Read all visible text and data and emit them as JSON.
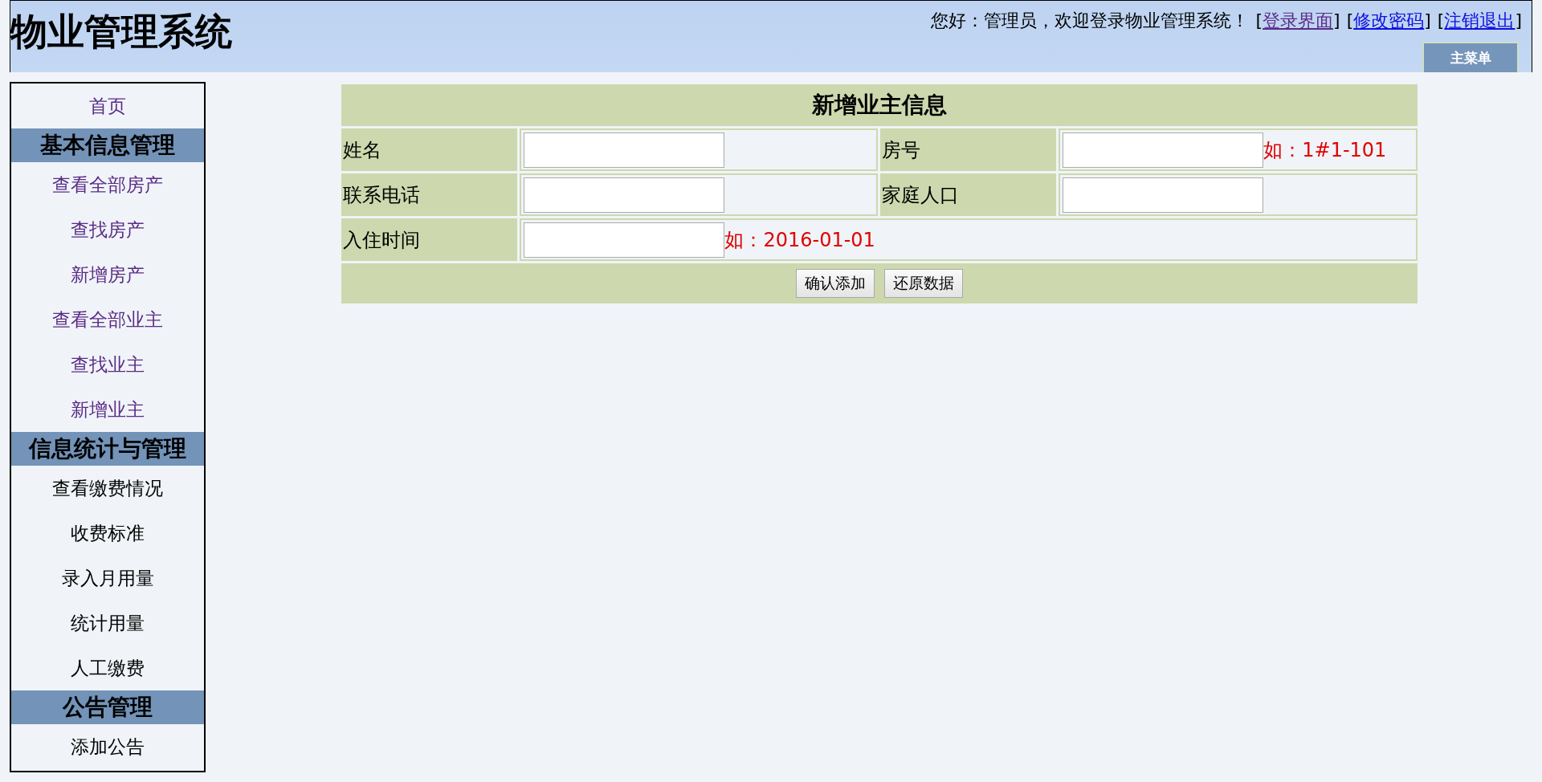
{
  "header": {
    "title": "物业管理系统",
    "greeting": "您好：管理员，欢迎登录物业管理系统！",
    "links": [
      {
        "prefix": "[",
        "label": "登录界面",
        "suffix": "]",
        "visited": true
      },
      {
        "prefix": "[",
        "label": "修改密码",
        "suffix": "]",
        "visited": false
      },
      {
        "prefix": "[",
        "label": "注销退出",
        "suffix": "]",
        "visited": false
      }
    ],
    "menu_tab": "主菜单"
  },
  "sidebar": {
    "items": [
      {
        "kind": "link",
        "label": "首页",
        "visited": true
      },
      {
        "kind": "heading",
        "label": "基本信息管理"
      },
      {
        "kind": "link",
        "label": "查看全部房产",
        "visited": true
      },
      {
        "kind": "link",
        "label": "查找房产",
        "visited": true
      },
      {
        "kind": "link",
        "label": "新增房产",
        "visited": true
      },
      {
        "kind": "link",
        "label": "查看全部业主",
        "visited": true
      },
      {
        "kind": "link",
        "label": "查找业主",
        "visited": true
      },
      {
        "kind": "link",
        "label": "新增业主",
        "visited": true
      },
      {
        "kind": "heading",
        "label": "信息统计与管理"
      },
      {
        "kind": "link",
        "label": "查看缴费情况",
        "visited": false
      },
      {
        "kind": "link",
        "label": "收费标准",
        "visited": false
      },
      {
        "kind": "link",
        "label": "录入月用量",
        "visited": false
      },
      {
        "kind": "link",
        "label": "统计用量",
        "visited": false
      },
      {
        "kind": "link",
        "label": "人工缴费",
        "visited": false
      },
      {
        "kind": "heading",
        "label": "公告管理"
      },
      {
        "kind": "link",
        "label": "添加公告",
        "visited": false
      }
    ]
  },
  "form": {
    "title": "新增业主信息",
    "rows": [
      [
        {
          "label": "姓名"
        },
        {
          "label": "房号",
          "hint": "如：1#1-101"
        }
      ],
      [
        {
          "label": "联系电话"
        },
        {
          "label": "家庭人口"
        }
      ],
      [
        {
          "label": "入住时间",
          "hint": "如：2016-01-01"
        }
      ]
    ],
    "buttons": [
      "确认添加",
      "还原数据"
    ]
  }
}
